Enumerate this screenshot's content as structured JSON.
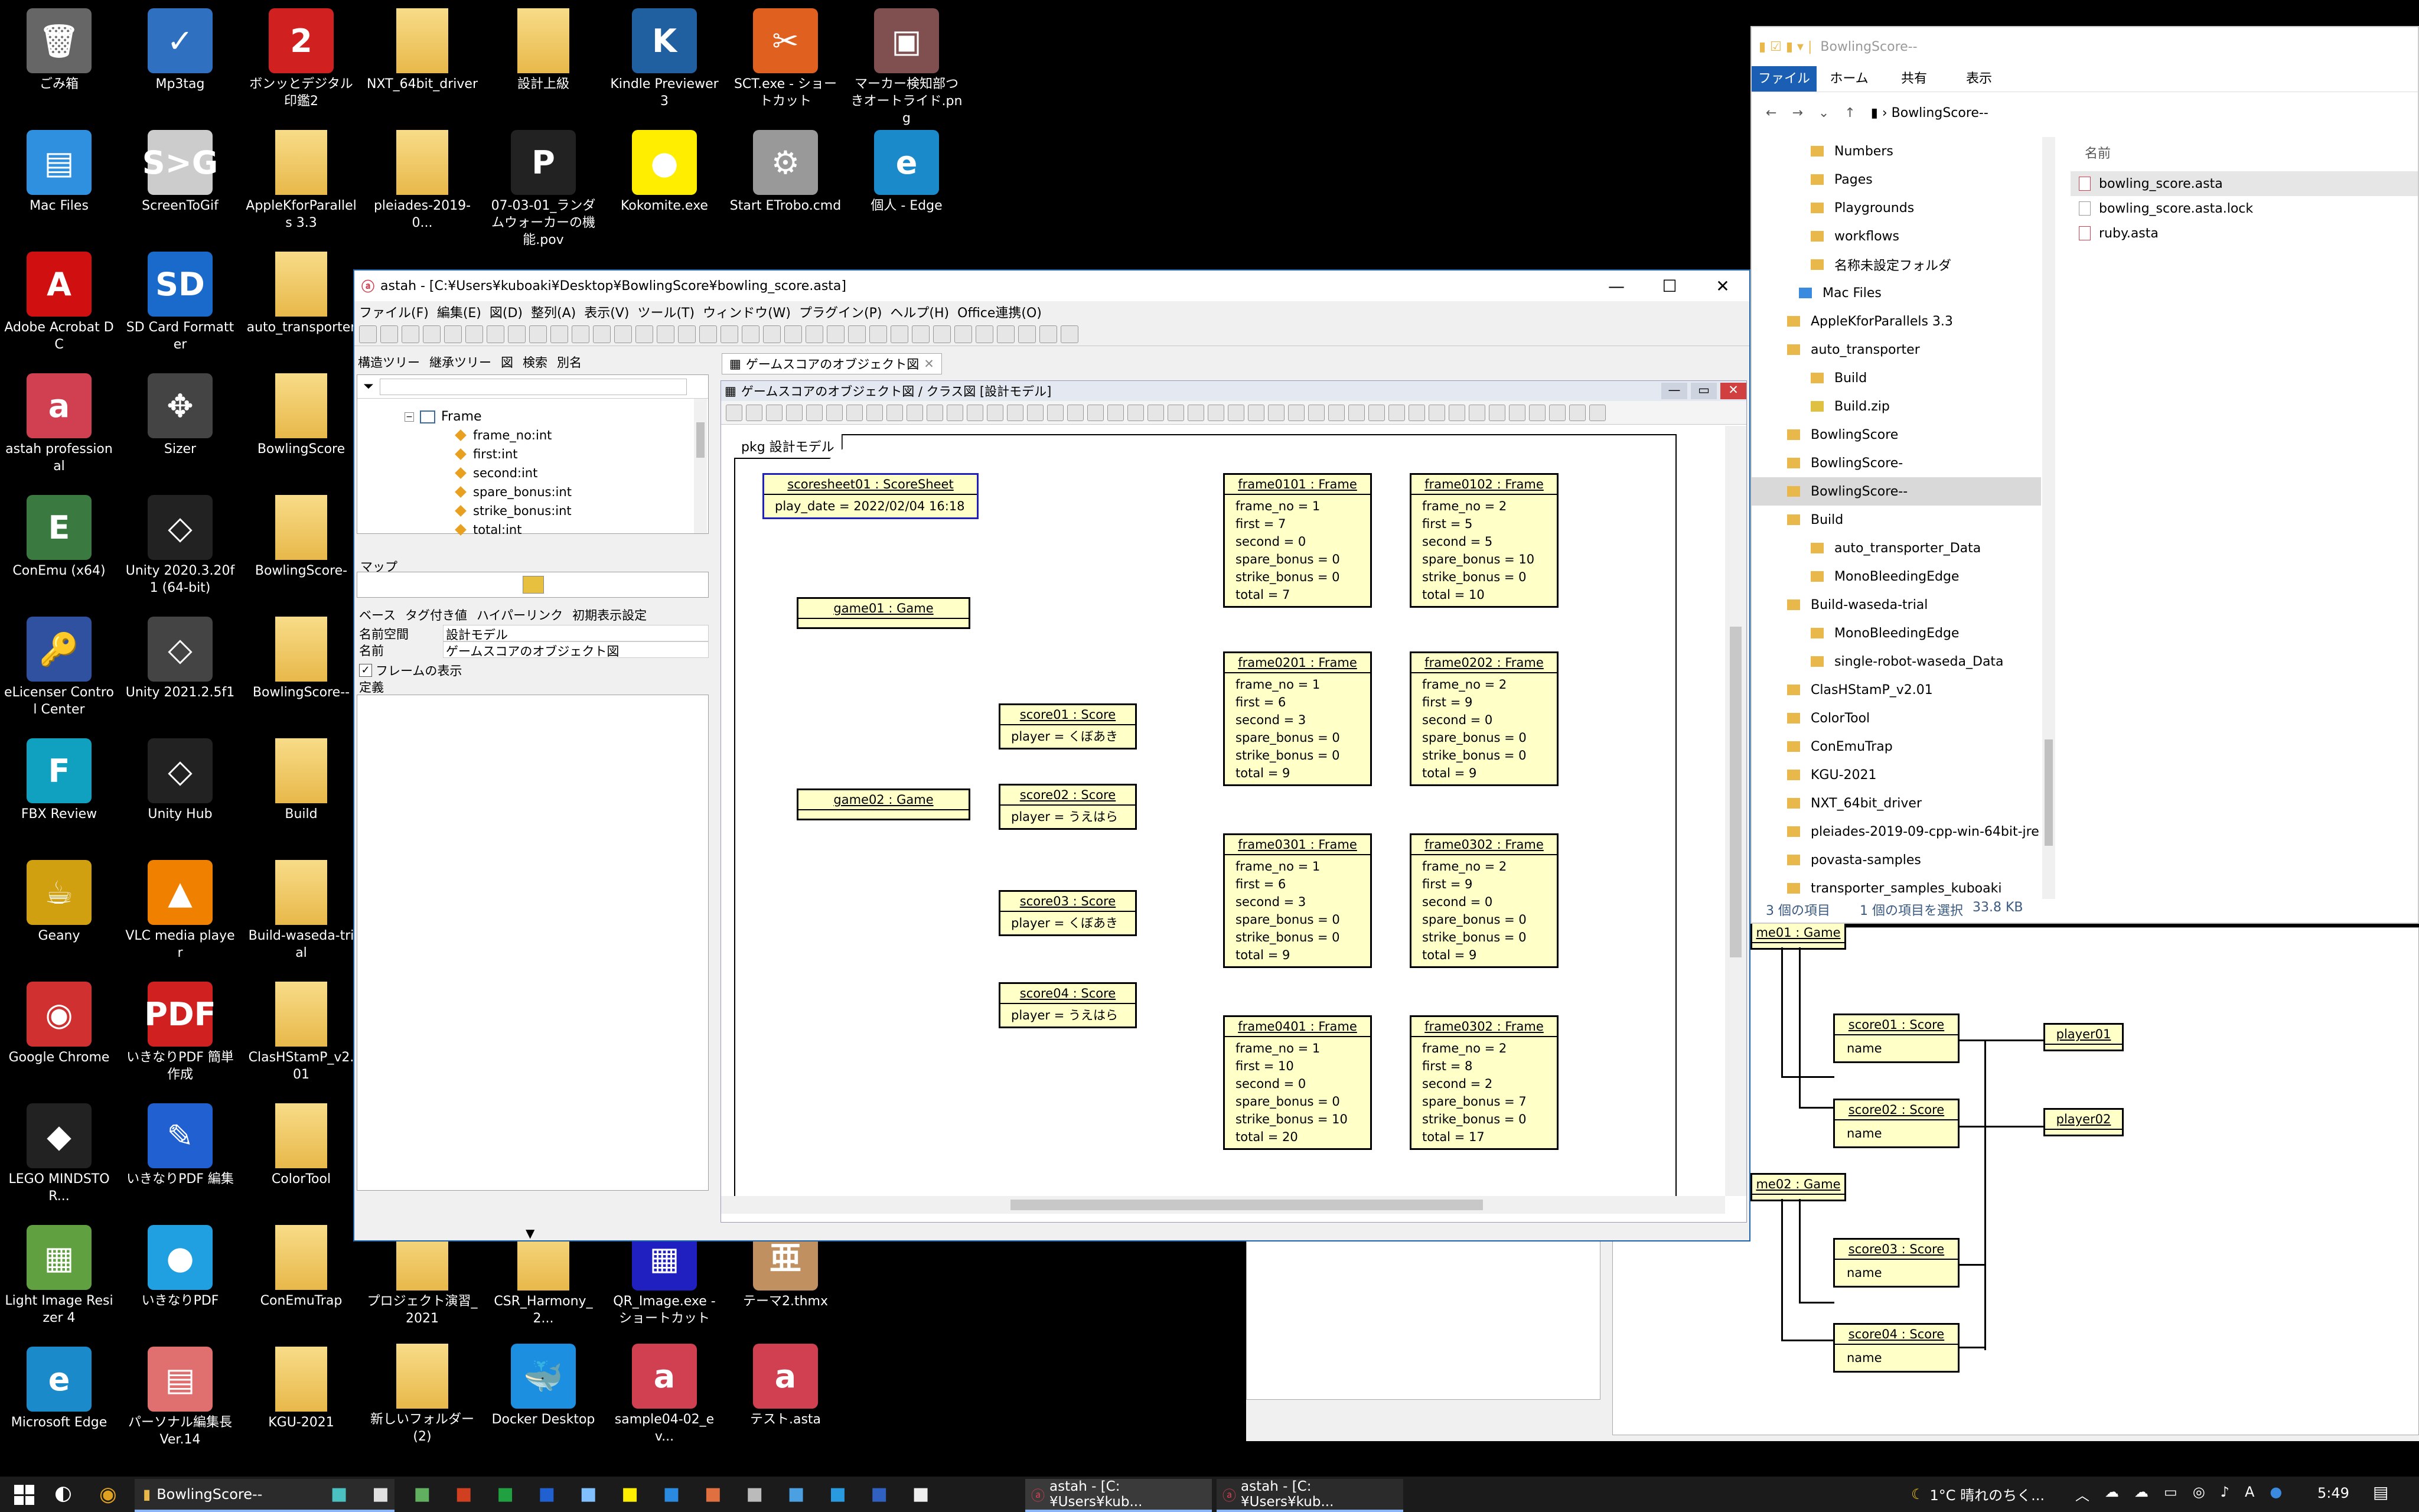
{
  "desktop": {
    "icons": [
      {
        "label": "ごみ箱",
        "glyph": "🗑",
        "color": "#666"
      },
      {
        "label": "Mp3tag",
        "glyph": "✓",
        "color": "#3070c0"
      },
      {
        "label": "ボンッとデジタル印鑑2",
        "glyph": "2",
        "color": "#d02020"
      },
      {
        "label": "NXT_64bit_driver",
        "glyph": "",
        "color": "folder"
      },
      {
        "label": "設計上級",
        "glyph": "",
        "color": "folder"
      },
      {
        "label": "Kindle Previewer 3",
        "glyph": "K",
        "color": "#2060a0"
      },
      {
        "label": "SCT.exe - ショートカット",
        "glyph": "✂",
        "color": "#e06020"
      },
      {
        "label": "マーカー検知部つきオートライド.png",
        "glyph": "▣",
        "color": "#805050"
      },
      {
        "label": "Mac Files",
        "glyph": "▤",
        "color": "#3090e0"
      },
      {
        "label": "ScreenToGif",
        "glyph": "S>G",
        "color": "#ccc"
      },
      {
        "label": "AppleKforParallels 3.3",
        "glyph": "",
        "color": "folder"
      },
      {
        "label": "pleiades-2019-0...",
        "glyph": "",
        "color": "folder"
      },
      {
        "label": "07-03-01_ランダムウォーカーの機能.pov",
        "glyph": "P",
        "color": "#222"
      },
      {
        "label": "Kokomite.exe",
        "glyph": "●",
        "color": "#ffee00"
      },
      {
        "label": "Start ETrobo.cmd",
        "glyph": "⚙",
        "color": "#999"
      },
      {
        "label": "個人 - Edge",
        "glyph": "e",
        "color": "#1a8acb"
      },
      {
        "label": "Adobe Acrobat DC",
        "glyph": "A",
        "color": "#d01010"
      },
      {
        "label": "SD Card Formatter",
        "glyph": "SD",
        "color": "#1a6acb"
      },
      {
        "label": "auto_transporter",
        "glyph": "",
        "color": "folder"
      },
      {
        "label": "astah professional",
        "glyph": "a",
        "color": "#d04050"
      },
      {
        "label": "Sizer",
        "glyph": "✥",
        "color": "#444"
      },
      {
        "label": "BowlingScore",
        "glyph": "",
        "color": "folder"
      },
      {
        "label": "ConEmu (x64)",
        "glyph": "E",
        "color": "#3a7a40"
      },
      {
        "label": "Unity 2020.3.20f1 (64-bit)",
        "glyph": "◇",
        "color": "#222"
      },
      {
        "label": "BowlingScore-",
        "glyph": "",
        "color": "folder"
      },
      {
        "label": "eLicenser Control Center",
        "glyph": "🔑",
        "color": "#3050a0"
      },
      {
        "label": "Unity 2021.2.5f1",
        "glyph": "◇",
        "color": "#444"
      },
      {
        "label": "BowlingScore--",
        "glyph": "",
        "color": "folder"
      },
      {
        "label": "FBX Review",
        "glyph": "F",
        "color": "#10a0c0"
      },
      {
        "label": "Unity Hub",
        "glyph": "◇",
        "color": "#222"
      },
      {
        "label": "Build",
        "glyph": "",
        "color": "folder"
      },
      {
        "label": "Geany",
        "glyph": "☕",
        "color": "#d0a010"
      },
      {
        "label": "VLC media player",
        "glyph": "▲",
        "color": "#f08000"
      },
      {
        "label": "Build-waseda-trial",
        "glyph": "",
        "color": "folder"
      },
      {
        "label": "Google Chrome",
        "glyph": "◉",
        "color": "#d03030"
      },
      {
        "label": "いきなりPDF 簡単作成",
        "glyph": "PDF",
        "color": "#d02020"
      },
      {
        "label": "ClasHStamP_v2.01",
        "glyph": "",
        "color": "folder"
      },
      {
        "label": "LEGO MINDSTOR...",
        "glyph": "◆",
        "color": "#222"
      },
      {
        "label": "いきなりPDF 編集",
        "glyph": "✎",
        "color": "#2060d0"
      },
      {
        "label": "ColorTool",
        "glyph": "",
        "color": "folder"
      },
      {
        "label": "Light Image Resizer 4",
        "glyph": "▦",
        "color": "#60a040"
      },
      {
        "label": "いきなりPDF",
        "glyph": "●",
        "color": "#20a0e0"
      },
      {
        "label": "ConEmuTrap",
        "glyph": "",
        "color": "folder"
      },
      {
        "label": "Microsoft Edge",
        "glyph": "e",
        "color": "#1a8acb"
      },
      {
        "label": "パーソナル編集長 Ver.14",
        "glyph": "▤",
        "color": "#e07070"
      },
      {
        "label": "KGU-2021",
        "glyph": "",
        "color": "folder"
      },
      {
        "label": "プロジェクト演習_2021",
        "glyph": "",
        "color": "folder"
      },
      {
        "label": "CSR_Harmony_2...",
        "glyph": "",
        "color": "folder"
      },
      {
        "label": "QR_Image.exe - ショートカット",
        "glyph": "▦",
        "color": "#2020c0"
      },
      {
        "label": "テーマ2.thmx",
        "glyph": "亜",
        "color": "#c09060"
      },
      {
        "label": "新しいフォルダー (2)",
        "glyph": "",
        "color": "folder"
      },
      {
        "label": "Docker Desktop",
        "glyph": "🐳",
        "color": "#1d8fe0"
      },
      {
        "label": "sample04-02_ev...",
        "glyph": "a",
        "color": "#d04050"
      },
      {
        "label": "テスト.asta",
        "glyph": "a",
        "color": "#d04050"
      }
    ]
  },
  "astah": {
    "title": "astah - [C:¥Users¥kuboaki¥Desktop¥BowlingScore¥bowling_score.asta]",
    "menu": [
      "ファイル(F)",
      "編集(E)",
      "図(D)",
      "整列(A)",
      "表示(V)",
      "ツール(T)",
      "ウィンドウ(W)",
      "プラグイン(P)",
      "ヘルプ(H)",
      "Office連携(O)"
    ],
    "tree_tabs": [
      "構造ツリー",
      "継承ツリー",
      "図",
      "検索",
      "別名"
    ],
    "tree": {
      "class": "Frame",
      "attrs": [
        "frame_no:int",
        "first:int",
        "second:int",
        "spare_bonus:int",
        "strike_bonus:int",
        "total:int"
      ]
    },
    "map_label": "マップ",
    "prop_tabs": [
      "ベース",
      "タグ付き値",
      "ハイパーリンク",
      "初期表示設定"
    ],
    "props": [
      {
        "key": "名前空間",
        "value": "設計モデル"
      },
      {
        "key": "名前",
        "value": "ゲームスコアのオブジェクト図"
      }
    ],
    "frame_check": "フレームの表示",
    "definition_label": "定義",
    "diagram_tab": "ゲームスコアのオブジェクト図",
    "inner_title": "ゲームスコアのオブジェクト図 / クラス図 [設計モデル]",
    "pkg": "pkg 設計モデル",
    "scoresheet": {
      "name": "scoresheet01 : ScoreSheet",
      "attr": "play_date = 2022/02/04 16:18"
    },
    "games": [
      "game01 : Game",
      "game02 : Game"
    ],
    "scores": [
      {
        "name": "score01 : Score",
        "attr": "player = くぼあき"
      },
      {
        "name": "score02 : Score",
        "attr": "player = うえはら"
      },
      {
        "name": "score03 : Score",
        "attr": "player = くぼあき"
      },
      {
        "name": "score04 : Score",
        "attr": "player = うえはら"
      }
    ],
    "frames": [
      {
        "name": "frame0101 : Frame",
        "attrs": [
          "frame_no = 1",
          "first = 7",
          "second = 0",
          "spare_bonus = 0",
          "strike_bonus = 0",
          "total = 7"
        ]
      },
      {
        "name": "frame0102 : Frame",
        "attrs": [
          "frame_no = 2",
          "first = 5",
          "second = 5",
          "spare_bonus = 10",
          "strike_bonus = 0",
          "total = 10"
        ]
      },
      {
        "name": "frame0201 : Frame",
        "attrs": [
          "frame_no = 1",
          "first = 6",
          "second = 3",
          "spare_bonus = 0",
          "strike_bonus = 0",
          "total = 9"
        ]
      },
      {
        "name": "frame0202 : Frame",
        "attrs": [
          "frame_no = 2",
          "first = 9",
          "second = 0",
          "spare_bonus = 0",
          "strike_bonus = 0",
          "total = 9"
        ]
      },
      {
        "name": "frame0301 : Frame",
        "attrs": [
          "frame_no = 1",
          "first = 6",
          "second = 3",
          "spare_bonus = 0",
          "strike_bonus = 0",
          "total = 9"
        ]
      },
      {
        "name": "frame0302 : Frame",
        "attrs": [
          "frame_no = 2",
          "first = 9",
          "second = 0",
          "spare_bonus = 0",
          "strike_bonus = 0",
          "total = 9"
        ]
      },
      {
        "name": "frame0401 : Frame",
        "attrs": [
          "frame_no = 1",
          "first = 10",
          "second = 0",
          "spare_bonus = 0",
          "strike_bonus = 10",
          "total = 20"
        ]
      },
      {
        "name": "frame0302 : Frame",
        "attrs": [
          "frame_no = 2",
          "first = 8",
          "second = 2",
          "spare_bonus = 7",
          "strike_bonus = 0",
          "total = 17"
        ]
      }
    ]
  },
  "explorer": {
    "title": "BowlingScore--",
    "ribbon": [
      "ファイル",
      "ホーム",
      "共有",
      "表示"
    ],
    "path": "BowlingScore--",
    "nav": [
      "Numbers",
      "Pages",
      "Playgrounds",
      "workflows",
      "名称未設定フォルダ",
      "Mac Files",
      "AppleKforParallels 3.3",
      "auto_transporter",
      "Build",
      "Build.zip",
      "BowlingScore",
      "BowlingScore-",
      "BowlingScore--",
      "Build",
      "auto_transporter_Data",
      "MonoBleedingEdge",
      "Build-waseda-trial",
      "MonoBleedingEdge",
      "single-robot-waseda_Data",
      "ClasHStamP_v2.01",
      "ColorTool",
      "ConEmuTrap",
      "KGU-2021",
      "NXT_64bit_driver",
      "pleiades-2019-09-cpp-win-64bit-jre",
      "povasta-samples",
      "transporter_samples_kuboaki"
    ],
    "col_header": "名前",
    "files": [
      "bowling_score.asta",
      "bowling_score.asta.lock",
      "ruby.asta"
    ],
    "status": [
      "3 個の項目",
      "1 個の項目を選択",
      "33.8 KB"
    ]
  },
  "back_diagram": {
    "games": [
      "me01 : Game",
      "me02 : Game"
    ],
    "scores": [
      "score01 : Score",
      "score02 : Score",
      "score03 : Score",
      "score04 : Score"
    ],
    "score_attr": "name",
    "players": [
      "player01",
      "player02"
    ]
  },
  "taskbar": {
    "explorer_label": "BowlingScore--",
    "astah1": "astah - [C:¥Users¥kub...",
    "astah2": "astah - [C:¥Users¥kub...",
    "weather": "1°C  晴れのちく...",
    "ime": "A",
    "time": "5:49"
  }
}
